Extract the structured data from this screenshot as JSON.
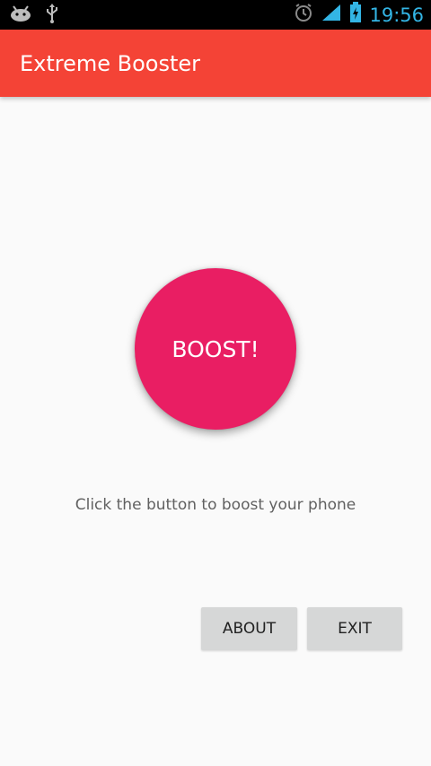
{
  "status_bar": {
    "icons": [
      "android-debug-icon",
      "usb-icon",
      "alarm-icon",
      "signal-icon",
      "battery-charging-icon"
    ],
    "time": "19:56"
  },
  "app_bar": {
    "title": "Extreme Booster",
    "color": "#f44336"
  },
  "main": {
    "boost_label": "BOOST!",
    "boost_color": "#e91e63",
    "hint": "Click the button to boost your phone"
  },
  "actions": {
    "about_label": "ABOUT",
    "exit_label": "EXIT"
  }
}
